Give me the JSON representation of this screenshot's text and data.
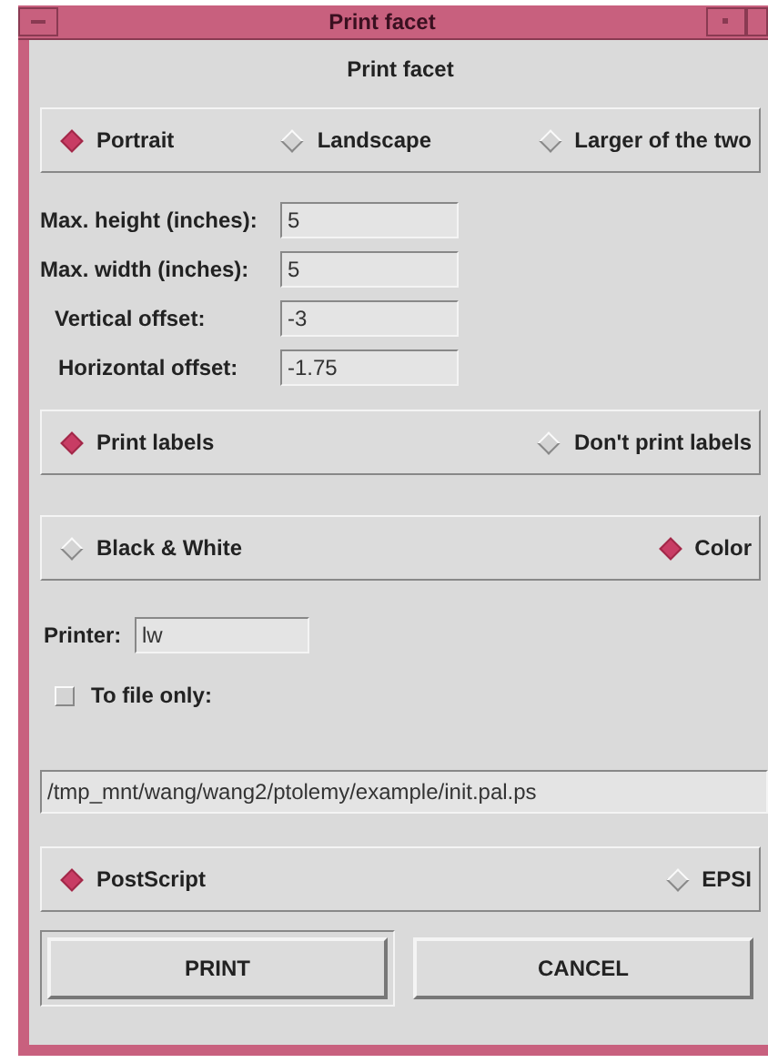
{
  "window": {
    "title": "Print facet"
  },
  "heading": "Print facet",
  "orientation": [
    {
      "label": "Portrait",
      "selected": true
    },
    {
      "label": "Landscape",
      "selected": false
    },
    {
      "label": "Larger of the two",
      "selected": false
    }
  ],
  "fields": [
    {
      "label": "Max. height (inches):",
      "value": "5"
    },
    {
      "label": "Max. width (inches):",
      "value": "5"
    },
    {
      "label": "Vertical offset:",
      "value": "-3"
    },
    {
      "label": "Horizontal offset:",
      "value": "-1.75"
    }
  ],
  "labels": [
    {
      "label": "Print labels",
      "selected": true
    },
    {
      "label": "Don't print labels",
      "selected": false
    }
  ],
  "color_mode": [
    {
      "label": "Black & White",
      "selected": false
    },
    {
      "label": "Color",
      "selected": true
    }
  ],
  "printer": {
    "label": "Printer:",
    "value": "lw"
  },
  "to_file": {
    "label": "To file only:",
    "checked": false
  },
  "file_path": "/tmp_mnt/wang/wang2/ptolemy/example/init.pal.ps",
  "format": [
    {
      "label": "PostScript",
      "selected": true
    },
    {
      "label": "EPSI",
      "selected": false
    }
  ],
  "buttons": [
    {
      "label": "PRINT",
      "default": true
    },
    {
      "label": "CANCEL",
      "default": false
    }
  ]
}
